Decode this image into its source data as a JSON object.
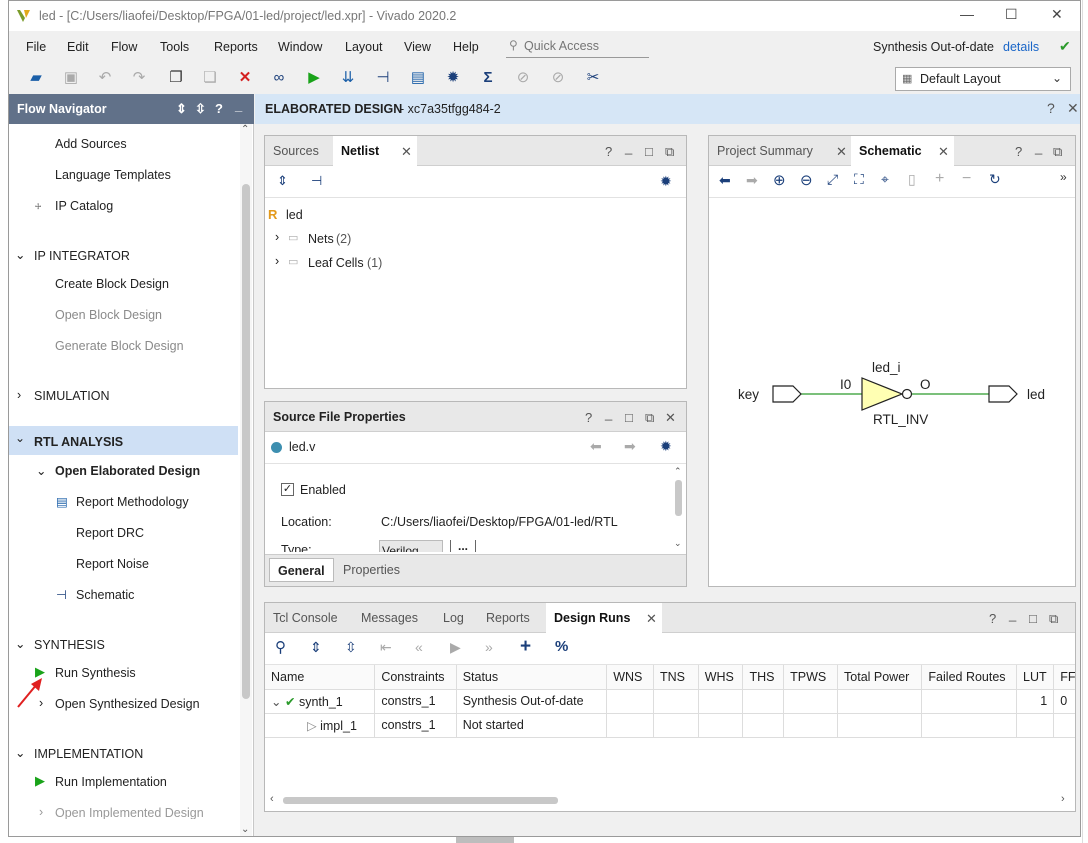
{
  "window": {
    "title": "led - [C:/Users/liaofei/Desktop/FPGA/01-led/project/led.xpr] - Vivado 2020.2",
    "minimize": "—",
    "maximize": "☐",
    "close": "✕"
  },
  "menu": [
    "File",
    "Edit",
    "Flow",
    "Tools",
    "Reports",
    "Window",
    "Layout",
    "View",
    "Help"
  ],
  "quick_access": {
    "placeholder": "Quick Access"
  },
  "status": {
    "text": "Synthesis Out-of-date",
    "details": "details"
  },
  "layout_select": {
    "value": "Default Layout"
  },
  "flow_navigator": {
    "title": "Flow Navigator",
    "items": [
      {
        "label": "Add Sources"
      },
      {
        "label": "Language Templates"
      },
      {
        "label": "IP Catalog"
      }
    ],
    "ip_integrator": {
      "label": "IP INTEGRATOR",
      "items": [
        "Create Block Design",
        "Open Block Design",
        "Generate Block Design"
      ]
    },
    "simulation": {
      "label": "SIMULATION"
    },
    "rtl_analysis": {
      "label": "RTL ANALYSIS",
      "open": "Open Elaborated Design",
      "items": [
        "Report Methodology",
        "Report DRC",
        "Report Noise",
        "Schematic"
      ]
    },
    "synthesis": {
      "label": "SYNTHESIS",
      "run": "Run Synthesis",
      "open": "Open Synthesized Design"
    },
    "implementation": {
      "label": "IMPLEMENTATION",
      "run": "Run Implementation",
      "open": "Open Implemented Design"
    }
  },
  "elaborated": {
    "title": "ELABORATED DESIGN",
    "part": " - xc7a35tfgg484-2"
  },
  "netlist_panel": {
    "tabs": [
      "Sources",
      "Netlist"
    ],
    "root": "led",
    "root_badge": "R",
    "nodes": [
      {
        "label": "Nets",
        "count": "(2)"
      },
      {
        "label": "Leaf Cells",
        "count": "(1)"
      }
    ]
  },
  "source_props": {
    "title": "Source File Properties",
    "file": "led.v",
    "enabled_label": "Enabled",
    "location_label": "Location:",
    "location_value": "C:/Users/liaofei/Desktop/FPGA/01-led/RTL",
    "type_label": "Type:",
    "type_value": "Verilog",
    "more": "...",
    "tabs": [
      "General",
      "Properties"
    ]
  },
  "schematic_panel": {
    "tabs": [
      "Project Summary",
      "Schematic"
    ],
    "more": "»",
    "key": "key",
    "led": "led",
    "inst": "led_i",
    "pin_in": "I0",
    "pin_out": "O",
    "cell": "RTL_INV"
  },
  "runs_panel": {
    "tabs": [
      "Tcl Console",
      "Messages",
      "Log",
      "Reports",
      "Design Runs"
    ],
    "columns": [
      "Name",
      "Constraints",
      "Status",
      "WNS",
      "TNS",
      "WHS",
      "THS",
      "TPWS",
      "Total Power",
      "Failed Routes",
      "LUT",
      "FF"
    ],
    "rows": [
      {
        "name": "synth_1",
        "constraints": "constrs_1",
        "status": "Synthesis Out-of-date",
        "lut": "1",
        "ff": "0"
      },
      {
        "name": "impl_1",
        "constraints": "constrs_1",
        "status": "Not started",
        "lut": "",
        "ff": ""
      }
    ]
  },
  "colors": {
    "navigator_header": "#617189",
    "elaborated_header": "#d6e6f6",
    "selected_section": "#cfe0f5",
    "run_green": "#1aa31a",
    "error_red": "#d42020",
    "link_blue": "#1a66c8",
    "wire_green": "#2c9a2c",
    "inverter_fill": "#ffffb3",
    "arrow_red": "#e02020"
  },
  "icons": [
    "vivado-logo",
    "open-project-icon",
    "save-icon",
    "undo-icon",
    "redo-icon",
    "copy-icon",
    "paste-icon",
    "delete-icon",
    "find-icon",
    "run-icon",
    "program-icon",
    "schematic-icon",
    "report-icon",
    "settings-icon",
    "sigma-icon",
    "check-icon",
    "search-icon",
    "zoom-in-icon",
    "zoom-out-icon",
    "fit-icon",
    "refresh-icon",
    "plus-icon",
    "percent-icon"
  ]
}
